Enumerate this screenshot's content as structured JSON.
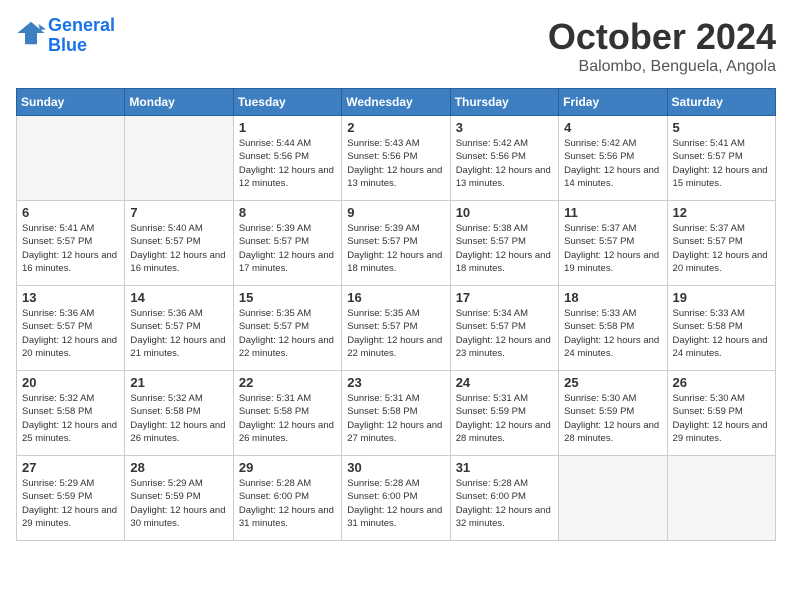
{
  "header": {
    "logo_line1": "General",
    "logo_line2": "Blue",
    "title": "October 2024",
    "subtitle": "Balombo, Benguela, Angola"
  },
  "weekdays": [
    "Sunday",
    "Monday",
    "Tuesday",
    "Wednesday",
    "Thursday",
    "Friday",
    "Saturday"
  ],
  "weeks": [
    [
      {
        "day": "",
        "empty": true
      },
      {
        "day": "",
        "empty": true
      },
      {
        "day": "1",
        "info": "Sunrise: 5:44 AM\nSunset: 5:56 PM\nDaylight: 12 hours\nand 12 minutes."
      },
      {
        "day": "2",
        "info": "Sunrise: 5:43 AM\nSunset: 5:56 PM\nDaylight: 12 hours\nand 13 minutes."
      },
      {
        "day": "3",
        "info": "Sunrise: 5:42 AM\nSunset: 5:56 PM\nDaylight: 12 hours\nand 13 minutes."
      },
      {
        "day": "4",
        "info": "Sunrise: 5:42 AM\nSunset: 5:56 PM\nDaylight: 12 hours\nand 14 minutes."
      },
      {
        "day": "5",
        "info": "Sunrise: 5:41 AM\nSunset: 5:57 PM\nDaylight: 12 hours\nand 15 minutes."
      }
    ],
    [
      {
        "day": "6",
        "info": "Sunrise: 5:41 AM\nSunset: 5:57 PM\nDaylight: 12 hours\nand 16 minutes."
      },
      {
        "day": "7",
        "info": "Sunrise: 5:40 AM\nSunset: 5:57 PM\nDaylight: 12 hours\nand 16 minutes."
      },
      {
        "day": "8",
        "info": "Sunrise: 5:39 AM\nSunset: 5:57 PM\nDaylight: 12 hours\nand 17 minutes."
      },
      {
        "day": "9",
        "info": "Sunrise: 5:39 AM\nSunset: 5:57 PM\nDaylight: 12 hours\nand 18 minutes."
      },
      {
        "day": "10",
        "info": "Sunrise: 5:38 AM\nSunset: 5:57 PM\nDaylight: 12 hours\nand 18 minutes."
      },
      {
        "day": "11",
        "info": "Sunrise: 5:37 AM\nSunset: 5:57 PM\nDaylight: 12 hours\nand 19 minutes."
      },
      {
        "day": "12",
        "info": "Sunrise: 5:37 AM\nSunset: 5:57 PM\nDaylight: 12 hours\nand 20 minutes."
      }
    ],
    [
      {
        "day": "13",
        "info": "Sunrise: 5:36 AM\nSunset: 5:57 PM\nDaylight: 12 hours\nand 20 minutes."
      },
      {
        "day": "14",
        "info": "Sunrise: 5:36 AM\nSunset: 5:57 PM\nDaylight: 12 hours\nand 21 minutes."
      },
      {
        "day": "15",
        "info": "Sunrise: 5:35 AM\nSunset: 5:57 PM\nDaylight: 12 hours\nand 22 minutes."
      },
      {
        "day": "16",
        "info": "Sunrise: 5:35 AM\nSunset: 5:57 PM\nDaylight: 12 hours\nand 22 minutes."
      },
      {
        "day": "17",
        "info": "Sunrise: 5:34 AM\nSunset: 5:57 PM\nDaylight: 12 hours\nand 23 minutes."
      },
      {
        "day": "18",
        "info": "Sunrise: 5:33 AM\nSunset: 5:58 PM\nDaylight: 12 hours\nand 24 minutes."
      },
      {
        "day": "19",
        "info": "Sunrise: 5:33 AM\nSunset: 5:58 PM\nDaylight: 12 hours\nand 24 minutes."
      }
    ],
    [
      {
        "day": "20",
        "info": "Sunrise: 5:32 AM\nSunset: 5:58 PM\nDaylight: 12 hours\nand 25 minutes."
      },
      {
        "day": "21",
        "info": "Sunrise: 5:32 AM\nSunset: 5:58 PM\nDaylight: 12 hours\nand 26 minutes."
      },
      {
        "day": "22",
        "info": "Sunrise: 5:31 AM\nSunset: 5:58 PM\nDaylight: 12 hours\nand 26 minutes."
      },
      {
        "day": "23",
        "info": "Sunrise: 5:31 AM\nSunset: 5:58 PM\nDaylight: 12 hours\nand 27 minutes."
      },
      {
        "day": "24",
        "info": "Sunrise: 5:31 AM\nSunset: 5:59 PM\nDaylight: 12 hours\nand 28 minutes."
      },
      {
        "day": "25",
        "info": "Sunrise: 5:30 AM\nSunset: 5:59 PM\nDaylight: 12 hours\nand 28 minutes."
      },
      {
        "day": "26",
        "info": "Sunrise: 5:30 AM\nSunset: 5:59 PM\nDaylight: 12 hours\nand 29 minutes."
      }
    ],
    [
      {
        "day": "27",
        "info": "Sunrise: 5:29 AM\nSunset: 5:59 PM\nDaylight: 12 hours\nand 29 minutes."
      },
      {
        "day": "28",
        "info": "Sunrise: 5:29 AM\nSunset: 5:59 PM\nDaylight: 12 hours\nand 30 minutes."
      },
      {
        "day": "29",
        "info": "Sunrise: 5:28 AM\nSunset: 6:00 PM\nDaylight: 12 hours\nand 31 minutes."
      },
      {
        "day": "30",
        "info": "Sunrise: 5:28 AM\nSunset: 6:00 PM\nDaylight: 12 hours\nand 31 minutes."
      },
      {
        "day": "31",
        "info": "Sunrise: 5:28 AM\nSunset: 6:00 PM\nDaylight: 12 hours\nand 32 minutes."
      },
      {
        "day": "",
        "empty": true
      },
      {
        "day": "",
        "empty": true
      }
    ]
  ]
}
